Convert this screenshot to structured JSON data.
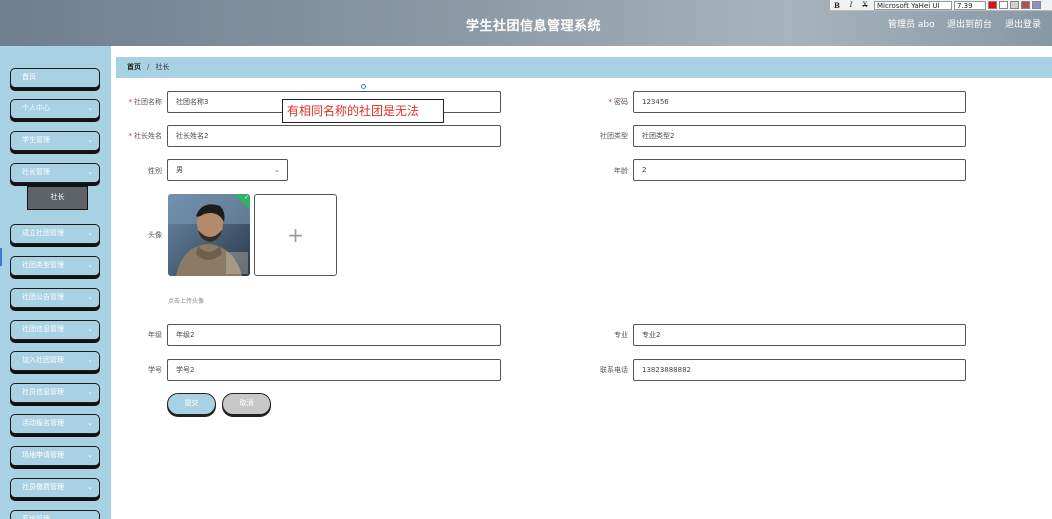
{
  "header": {
    "title": "学生社团信息管理系统",
    "admin_label": "管理员 abo",
    "front_label": "退出到前台",
    "logout_label": "退出登录"
  },
  "text_toolbar": {
    "bold": "B",
    "italic": "I",
    "strike": "X",
    "font": "Microsoft YaHei UI",
    "size": "7.39",
    "colors": [
      "#e01010",
      "#ffffff",
      "#d0d0d0",
      "#b05050",
      "#9090c0",
      "#c0a0a0",
      "#e8e8e8"
    ]
  },
  "sidebar": {
    "items": [
      {
        "label": "首页",
        "has_chevron": false
      },
      {
        "label": "个人中心",
        "has_chevron": true
      },
      {
        "label": "学生管理",
        "has_chevron": true
      },
      {
        "label": "社长管理",
        "has_chevron": true
      },
      {
        "label": "成立社团管理",
        "has_chevron": true
      },
      {
        "label": "社团类型管理",
        "has_chevron": true
      },
      {
        "label": "社团公告管理",
        "has_chevron": true
      },
      {
        "label": "社团信息管理",
        "has_chevron": true
      },
      {
        "label": "加入社团管理",
        "has_chevron": true
      },
      {
        "label": "社员信息管理",
        "has_chevron": true
      },
      {
        "label": "活动报名管理",
        "has_chevron": true
      },
      {
        "label": "场地申请管理",
        "has_chevron": true
      },
      {
        "label": "社员缴费管理",
        "has_chevron": true
      },
      {
        "label": "系统管理",
        "has_chevron": true
      }
    ],
    "submenu_item": "社长"
  },
  "breadcrumb": {
    "home": "首页",
    "separator": "/",
    "current": "社长"
  },
  "form": {
    "club_name": {
      "label": "社团名称",
      "value": "社团名称3",
      "required": true
    },
    "password": {
      "label": "密码",
      "value": "123456",
      "required": true
    },
    "leader_name": {
      "label": "社长姓名",
      "value": "社长姓名2",
      "required": true
    },
    "club_type": {
      "label": "社团类型",
      "value": "社团类型2",
      "required": false
    },
    "gender": {
      "label": "性别",
      "value": "男"
    },
    "age": {
      "label": "年龄",
      "value": "2"
    },
    "avatar": {
      "label": "头像",
      "upload_hint": "点击上传头像",
      "plus": "+"
    },
    "grade": {
      "label": "年级",
      "value": "年级2"
    },
    "major": {
      "label": "专业",
      "value": "专业2"
    },
    "student_id": {
      "label": "学号",
      "value": "学号2"
    },
    "phone": {
      "label": "联系电话",
      "value": "13823888882"
    },
    "submit_label": "提交",
    "cancel_label": "取消"
  },
  "annotation": {
    "text": "有相同名称的社团是无法",
    "color": "#e0302b"
  },
  "colors": {
    "accent": "#a9d1e4",
    "required": "#e02020",
    "success": "#2fb363"
  }
}
